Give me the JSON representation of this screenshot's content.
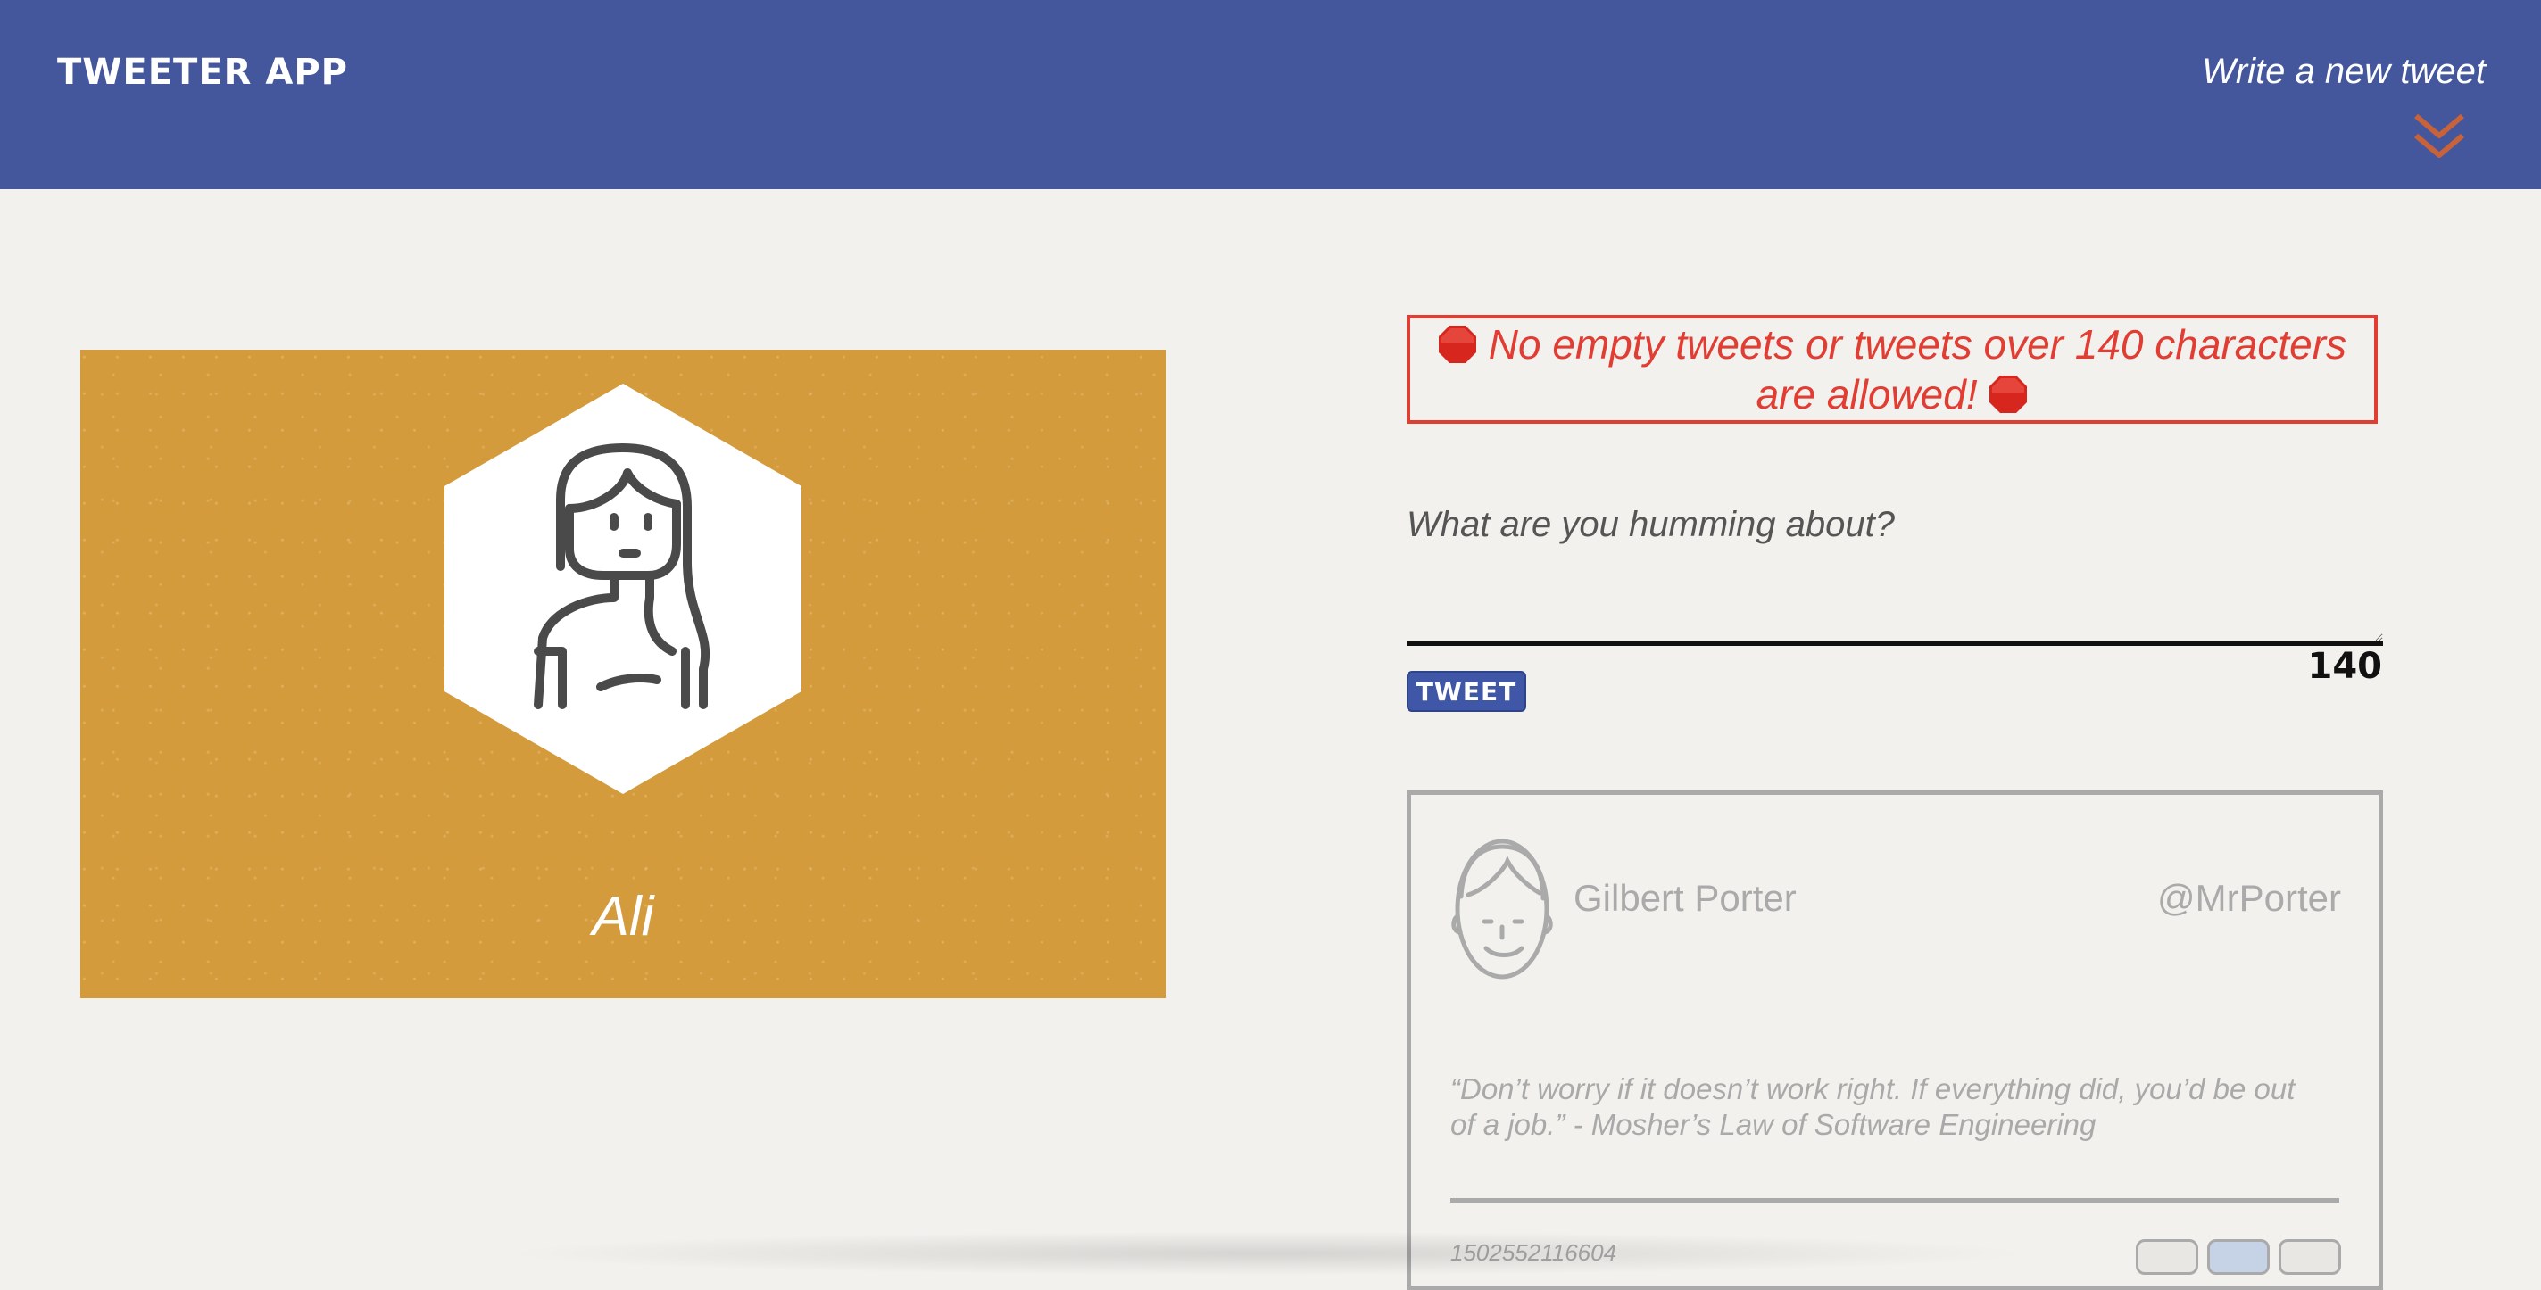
{
  "header": {
    "brand": "TWEETER APP",
    "compose_label": "Write a new tweet",
    "compose_icon": "double-chevron-down-icon"
  },
  "profile": {
    "name": "Ali",
    "avatar_icon": "user-avatar-icon",
    "background_color": "#d49b3d"
  },
  "composer": {
    "error_message": "No empty tweets or tweets over 140 characters are allowed!",
    "error_icon": "stop-sign-icon",
    "placeholder": "What are you humming about?",
    "value": "",
    "submit_label": "TWEET",
    "char_counter": "140"
  },
  "tweets": [
    {
      "author_name": "Gilbert Porter",
      "handle": "@MrPorter",
      "text": "“Don’t worry if it doesn’t work right. If everything did, you’d be out of a job.” - Mosher’s Law of Software Engineering",
      "timestamp": "1502552116604"
    }
  ],
  "colors": {
    "header_bg": "#44579d",
    "page_bg": "#f2f1ee",
    "error": "#e23d33",
    "accent_chevron": "#c8623a"
  }
}
